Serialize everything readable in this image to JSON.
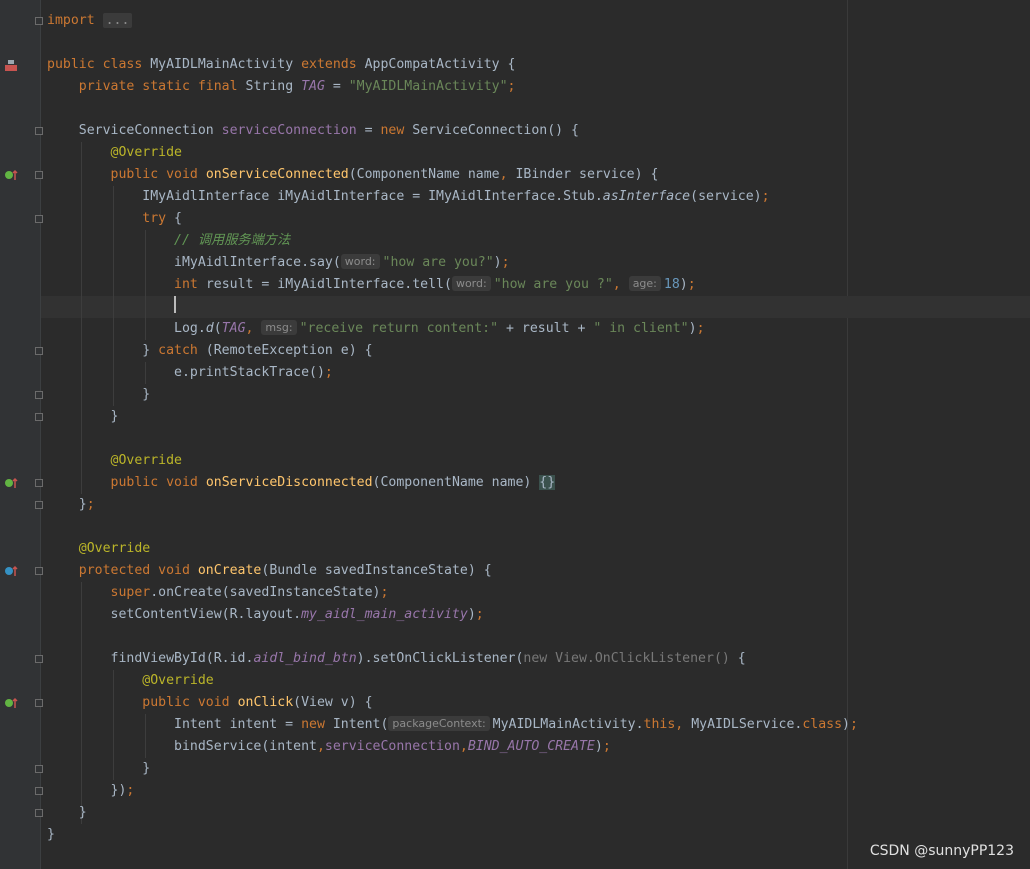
{
  "editor": {
    "watermark": "CSDN @sunnyPP123",
    "line_numbers_visible": false,
    "lines": [
      [
        [
          "kw",
          "import"
        ],
        [
          "p",
          " "
        ],
        [
          "fold",
          "..."
        ]
      ],
      [],
      [
        [
          "kw",
          "public class "
        ],
        [
          "p",
          "MyAIDLMainActivity "
        ],
        [
          "kw",
          "extends "
        ],
        [
          "p",
          "AppCompatActivity {"
        ]
      ],
      [
        [
          "p",
          "    "
        ],
        [
          "kw",
          "private static final "
        ],
        [
          "p",
          "String "
        ],
        [
          "st",
          "TAG"
        ],
        [
          "p",
          " = "
        ],
        [
          "str",
          "\"MyAIDLMainActivity\""
        ],
        [
          "kw",
          ";"
        ]
      ],
      [],
      [
        [
          "p",
          "    ServiceConnection "
        ],
        [
          "fld",
          "serviceConnection"
        ],
        [
          "p",
          " = "
        ],
        [
          "kw",
          "new "
        ],
        [
          "p",
          "ServiceConnection() {"
        ]
      ],
      [
        [
          "p",
          "        "
        ],
        [
          "ann",
          "@Override"
        ]
      ],
      [
        [
          "p",
          "        "
        ],
        [
          "kw",
          "public void "
        ],
        [
          "fn",
          "onServiceConnected"
        ],
        [
          "p",
          "(ComponentName name"
        ],
        [
          "kw",
          ", "
        ],
        [
          "p",
          "IBinder service) {"
        ]
      ],
      [
        [
          "p",
          "            IMyAidlInterface iMyAidlInterface = IMyAidlInterface.Stub."
        ],
        [
          "it",
          "asInterface"
        ],
        [
          "p",
          "(service)"
        ],
        [
          "kw",
          ";"
        ]
      ],
      [
        [
          "p",
          "            "
        ],
        [
          "kw",
          "try "
        ],
        [
          "p",
          "{"
        ]
      ],
      [
        [
          "p",
          "                "
        ],
        [
          "cmt",
          "// 调用服务端方法"
        ]
      ],
      [
        [
          "p",
          "                iMyAidlInterface.say("
        ],
        [
          "hint",
          "word:"
        ],
        [
          "str",
          "\"how are you?\""
        ],
        [
          "p",
          ")"
        ],
        [
          "kw",
          ";"
        ]
      ],
      [
        [
          "p",
          "                "
        ],
        [
          "kw",
          "int "
        ],
        [
          "p",
          "result = iMyAidlInterface.tell("
        ],
        [
          "hint",
          "word:"
        ],
        [
          "str",
          "\"how are you ?\""
        ],
        [
          "kw",
          ", "
        ],
        [
          "hint",
          "age:"
        ],
        [
          "num",
          "18"
        ],
        [
          "p",
          ")"
        ],
        [
          "kw",
          ";"
        ]
      ],
      [
        [
          "p",
          "                "
        ],
        [
          "caret",
          ""
        ]
      ],
      [
        [
          "p",
          "                Log."
        ],
        [
          "it",
          "d"
        ],
        [
          "p",
          "("
        ],
        [
          "st",
          "TAG"
        ],
        [
          "kw",
          ", "
        ],
        [
          "hint",
          "msg:"
        ],
        [
          "str",
          "\"receive return content:\""
        ],
        [
          "p",
          " + result + "
        ],
        [
          "str",
          "\" in client\""
        ],
        [
          "p",
          ")"
        ],
        [
          "kw",
          ";"
        ]
      ],
      [
        [
          "p",
          "            } "
        ],
        [
          "kw",
          "catch "
        ],
        [
          "p",
          "(RemoteException e) {"
        ]
      ],
      [
        [
          "p",
          "                e.printStackTrace()"
        ],
        [
          "kw",
          ";"
        ]
      ],
      [
        [
          "p",
          "            }"
        ]
      ],
      [
        [
          "p",
          "        }"
        ]
      ],
      [],
      [
        [
          "p",
          "        "
        ],
        [
          "ann",
          "@Override"
        ]
      ],
      [
        [
          "p",
          "        "
        ],
        [
          "kw",
          "public void "
        ],
        [
          "fn",
          "onServiceDisconnected"
        ],
        [
          "p",
          "(ComponentName name) "
        ],
        [
          "bh",
          "{}"
        ]
      ],
      [
        [
          "p",
          "    }"
        ],
        [
          "kw",
          ";"
        ]
      ],
      [],
      [
        [
          "p",
          "    "
        ],
        [
          "ann",
          "@Override"
        ]
      ],
      [
        [
          "p",
          "    "
        ],
        [
          "kw",
          "protected void "
        ],
        [
          "fn",
          "onCreate"
        ],
        [
          "p",
          "(Bundle savedInstanceState) {"
        ]
      ],
      [
        [
          "p",
          "        "
        ],
        [
          "kw",
          "super"
        ],
        [
          "p",
          ".onCreate(savedInstanceState)"
        ],
        [
          "kw",
          ";"
        ]
      ],
      [
        [
          "p",
          "        setContentView(R.layout."
        ],
        [
          "st",
          "my_aidl_main_activity"
        ],
        [
          "p",
          ")"
        ],
        [
          "kw",
          ";"
        ]
      ],
      [],
      [
        [
          "p",
          "        findViewById(R.id."
        ],
        [
          "st",
          "aidl_bind_btn"
        ],
        [
          "p",
          ").setOnClickListener("
        ],
        [
          "gray",
          "new View.OnClickListener()"
        ],
        [
          "p",
          " {"
        ]
      ],
      [
        [
          "p",
          "            "
        ],
        [
          "ann",
          "@Override"
        ]
      ],
      [
        [
          "p",
          "            "
        ],
        [
          "kw",
          "public void "
        ],
        [
          "fn",
          "onClick"
        ],
        [
          "p",
          "(View v) {"
        ]
      ],
      [
        [
          "p",
          "                Intent intent = "
        ],
        [
          "kw",
          "new "
        ],
        [
          "p",
          "Intent("
        ],
        [
          "hint",
          "packageContext:"
        ],
        [
          "p",
          "MyAIDLMainActivity."
        ],
        [
          "kw",
          "this"
        ],
        [
          "kw",
          ", "
        ],
        [
          "p",
          "MyAIDLService."
        ],
        [
          "kw",
          "class"
        ],
        [
          "p",
          ")"
        ],
        [
          "kw",
          ";"
        ]
      ],
      [
        [
          "p",
          "                bindService(intent"
        ],
        [
          "kw",
          ","
        ],
        [
          "fld",
          "serviceConnection"
        ],
        [
          "kw",
          ","
        ],
        [
          "st",
          "BIND_AUTO_CREATE"
        ],
        [
          "p",
          ")"
        ],
        [
          "kw",
          ";"
        ]
      ],
      [
        [
          "p",
          "            }"
        ]
      ],
      [
        [
          "p",
          "        })"
        ],
        [
          "kw",
          ";"
        ]
      ],
      [
        [
          "p",
          "    }"
        ]
      ],
      [
        [
          "p",
          "}"
        ]
      ]
    ]
  },
  "gutter_icons": [
    {
      "line": 2,
      "icon": "android-activity-class-icon",
      "color": "#c75450"
    },
    {
      "line": 7,
      "icon": "implements-method-icon",
      "color": "#62b543"
    },
    {
      "line": 21,
      "icon": "implements-method-icon",
      "color": "#62b543"
    },
    {
      "line": 25,
      "icon": "overrides-method-icon",
      "color": "#3592c4"
    },
    {
      "line": 31,
      "icon": "implements-method-icon",
      "color": "#62b543"
    }
  ],
  "fold_markers": [
    0,
    5,
    7,
    9,
    15,
    17,
    18,
    21,
    22,
    25,
    29,
    31,
    34,
    35,
    36
  ],
  "colors": {
    "background": "#2b2b2b",
    "gutter": "#313335",
    "keyword": "#cc7832",
    "annotation": "#bbb529",
    "method_decl": "#ffc66d",
    "string": "#6a8759",
    "number": "#6897bb",
    "field": "#9876aa",
    "comment": "#629755",
    "text": "#a9b7c6"
  }
}
